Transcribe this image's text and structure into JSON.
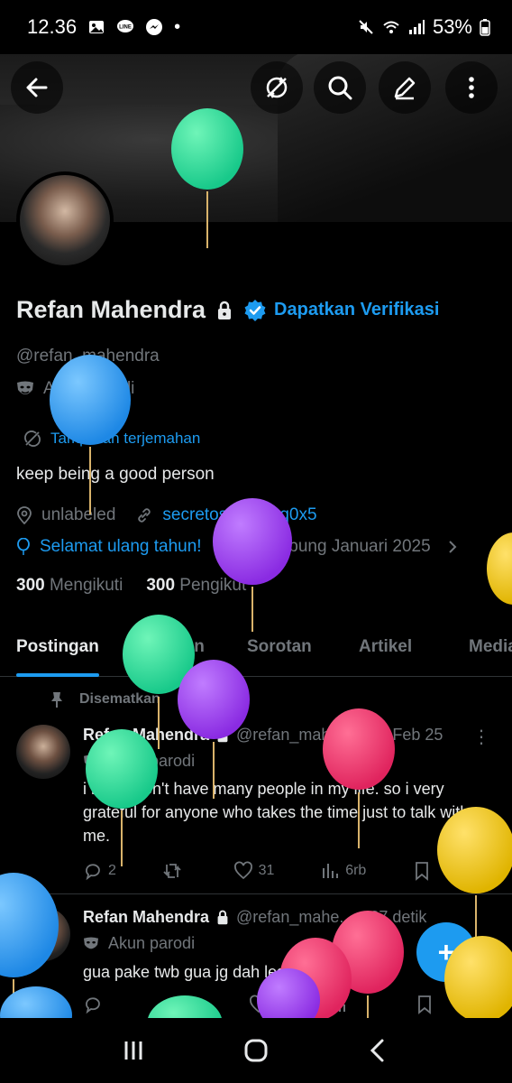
{
  "status_bar": {
    "time": "12.36",
    "battery": "53%",
    "left_icons": [
      "image-icon",
      "line-icon",
      "messenger-icon",
      "dot-icon"
    ],
    "right_icons": [
      "mute-icon",
      "wifi-icon",
      "signal-icon",
      "battery-icon"
    ]
  },
  "header": {
    "back_icon": "back-arrow-icon",
    "actions": [
      "translate-off-icon",
      "search-icon",
      "edit-icon",
      "more-vertical-icon"
    ]
  },
  "profile": {
    "name": "Refan Mahendra",
    "verify_link": "Dapatkan Verifikasi",
    "handle": "@refan_mahendra",
    "parody_label": "Akun parodi",
    "translate_label": "Tampilkan terjemahan",
    "bio": "keep being a good person",
    "location": "unlabeled",
    "website": "secretostate/ahq0x5",
    "birthday": "Selamat ulang tahun!",
    "joined": "Bergabung Januari 2025",
    "following_count": "300",
    "following_label": "Mengikuti",
    "followers_count": "300",
    "followers_label": "Pengikut"
  },
  "tabs": [
    "Postingan",
    "Balasan",
    "Sorotan",
    "Artikel",
    "Media"
  ],
  "pinned_label": "Disematkan",
  "tweets": [
    {
      "name": "Refan Mahendra",
      "handle": "@refan_mahe...",
      "time": "· 20 Feb 25",
      "parody": "Akun parodi",
      "text": "i really don't have many people in my life. so i very grateful for anyone who takes the time just to talk with me.",
      "replies": "2",
      "retweets": "",
      "likes": "31",
      "views": "6rb"
    },
    {
      "name": "Refan Mahendra",
      "handle": "@refan_mahe...",
      "time": "· 27 detik",
      "parody": "Akun parodi",
      "text": "gua pake twb gua jg dah lesin wk wk"
    }
  ],
  "fab_label": "+",
  "colors": {
    "background": "#000000",
    "accent": "#1d9bf0",
    "muted": "#71767b",
    "text": "#e7e9ea",
    "divider": "#2f3336"
  }
}
